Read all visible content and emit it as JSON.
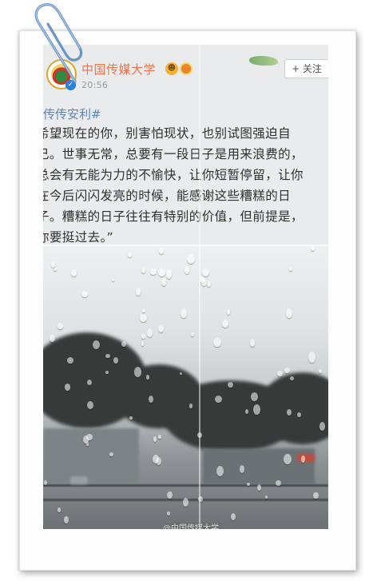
{
  "post": {
    "account_name": "中国传媒大学",
    "time": "20:56",
    "follow_label": "+ 关注",
    "hashtag": "传传安利#",
    "body_lines": [
      "希望现在的你，别害怕现状，也别试图强迫自",
      "己。世事无常，总要有一段日子是用来浪费的，",
      "总会有无能为力的不愉快，让你短暂停留，让你",
      "在今后闪闪发亮的时候，能感谢这些糟糕的日",
      "子。糟糕的日子往往有特别的价值，但前提是，",
      "你要挺过去。”"
    ],
    "watermark": "@中国传媒大学"
  },
  "icons": {
    "paperclip": "paperclip-icon",
    "avatar": "university-logo",
    "verified": "verified-badge-icon",
    "badges": [
      "vip-badge-icon",
      "medal-badge-icon"
    ]
  },
  "colors": {
    "account_name": "#eb7350",
    "hashtag": "#5d85b6",
    "follow_plus": "#ff8200"
  }
}
